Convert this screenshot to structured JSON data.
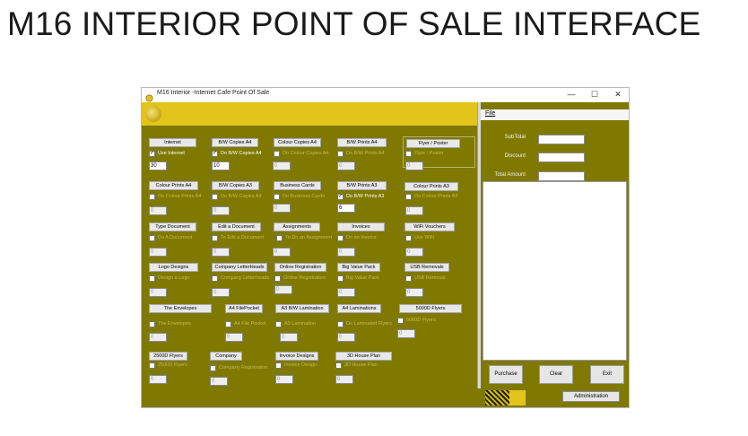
{
  "heading": "M16 INTERIOR POINT OF SALE INTERFACE",
  "window": {
    "title": "M16 Interior -Internet Cafe Point Of Sale",
    "minimize": "—",
    "maximize": "☐",
    "close": "✕"
  },
  "menu": {
    "file": "File"
  },
  "totals": {
    "subtotal_label": "SubTotal",
    "discount_label": "Discount",
    "total_label": "Total Amount",
    "subtotal_value": "",
    "discount_value": "",
    "total_value": ""
  },
  "actions": {
    "purchase": "Purchase",
    "clear": "Clear",
    "exit": "Exit",
    "administration": "Administration"
  },
  "services": [
    {
      "button": "Internet",
      "check": "Use Internet",
      "checked": true,
      "value": "30"
    },
    {
      "button": "B/W Copies A4",
      "check": "Do B/W Copies A4",
      "checked": true,
      "value": "10"
    },
    {
      "button": "Colour Copies A4",
      "check": "Do Colour Copies A4",
      "checked": false,
      "value": "0"
    },
    {
      "button": "B/W Prints A4",
      "check": "Do B/W Prints A4",
      "checked": false,
      "value": "0"
    },
    {
      "button": "Flyer / Poster",
      "check": "Flyer / Poster",
      "checked": false,
      "value": "0"
    },
    {
      "button": "Colour Prints A4",
      "check": "Do Colour Prints A4",
      "checked": false,
      "value": "0"
    },
    {
      "button": "B/W Copies A3",
      "check": "Do B/W Copies A3",
      "checked": false,
      "value": "0"
    },
    {
      "button": "Business Cards",
      "check": "Do Business Cards",
      "checked": false,
      "value": "0"
    },
    {
      "button": "B/W Prints A3",
      "check": "Do B/W Prints A3",
      "checked": true,
      "value": "6"
    },
    {
      "button": "Colour Prints A3",
      "check": "Do Colour Prints A3",
      "checked": false,
      "value": "0"
    },
    {
      "button": "Type Document",
      "check": "Do A Document",
      "checked": false,
      "value": "0"
    },
    {
      "button": "Edit a Document",
      "check": "To Edit a Document",
      "checked": false,
      "value": "0"
    },
    {
      "button": "Assignments",
      "check": "To Do an Assignment",
      "checked": false,
      "value": "0"
    },
    {
      "button": "Invoices",
      "check": "Do an Invoice",
      "checked": false,
      "value": "0"
    },
    {
      "button": "WiFi Vouchers",
      "check": "Use WiFi",
      "checked": false,
      "value": "0"
    },
    {
      "button": "Logo Designs",
      "check": "Design a Logo",
      "checked": false,
      "value": "0"
    },
    {
      "button": "Company LetterHeads",
      "check": "Company Letterheads",
      "checked": false,
      "value": "0"
    },
    {
      "button": "Online Registration",
      "check": "Online Registration",
      "checked": false,
      "value": "0"
    },
    {
      "button": "Big Value Pack",
      "check": "Big Value Pack",
      "checked": false,
      "value": "0"
    },
    {
      "button": "USB Removals",
      "check": "USB Removal",
      "checked": false,
      "value": "0"
    },
    {
      "button": "The Envelopes",
      "check": "The Envelopes",
      "checked": false,
      "value": "0"
    },
    {
      "button": "A4 FilePocket",
      "check": "A4 File Pocket",
      "checked": false,
      "value": "0"
    },
    {
      "button": "A3 B/W Lamination",
      "check": "A3 Lamination",
      "checked": false,
      "value": "0"
    },
    {
      "button": "A4 Laminations",
      "check": "Do Laminated Flyers",
      "checked": false,
      "value": "0"
    },
    {
      "button": "5000D Flyers",
      "check": "5000D Flyers",
      "checked": false,
      "value": "0"
    },
    {
      "button": "2500D Flyers",
      "check": "2500D Flyers",
      "checked": false,
      "value": "0"
    },
    {
      "button": "Company",
      "check": "Company Registration",
      "checked": false,
      "value": "0"
    },
    {
      "button": "Invoice Designs",
      "check": "Invoice Design",
      "checked": false,
      "value": "0"
    },
    {
      "button": "3D House Plan",
      "check": "3D House Plan",
      "checked": false,
      "value": "0"
    }
  ],
  "colors": {
    "panel": "#7f7900",
    "accent_yellow": "#e2c41b"
  },
  "icons": {
    "logo": "coin-logo-icon"
  }
}
